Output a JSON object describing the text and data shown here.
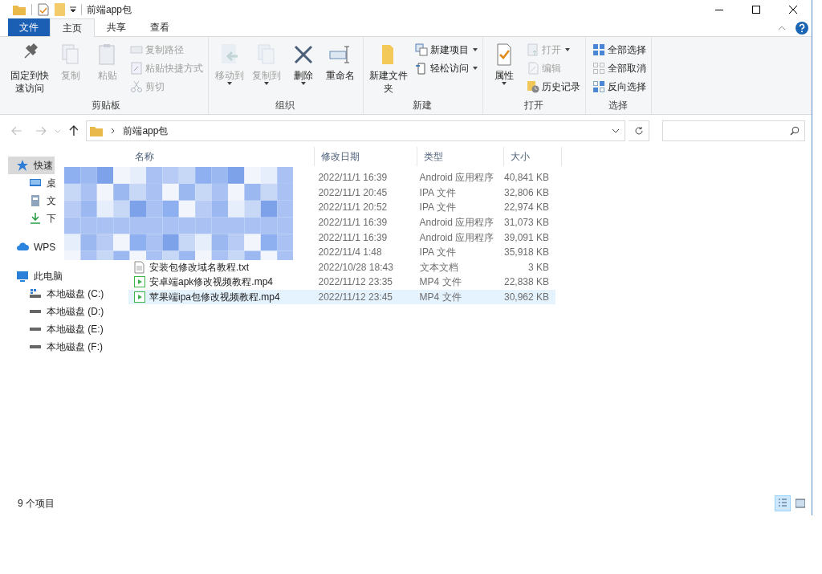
{
  "window": {
    "title": "前端app包"
  },
  "ribbon": {
    "tabs": [
      {
        "label": "文件",
        "kind": "file",
        "selected": false
      },
      {
        "label": "主页",
        "kind": "tab",
        "selected": true
      },
      {
        "label": "共享",
        "kind": "tab",
        "selected": false
      },
      {
        "label": "查看",
        "kind": "tab",
        "selected": false
      }
    ],
    "groups": [
      {
        "label": "剪贴板",
        "items": [
          {
            "label": "固定到快速访问",
            "kind": "large",
            "disabled": false,
            "menu": false
          },
          {
            "label": "复制",
            "kind": "large",
            "disabled": true,
            "menu": false
          },
          {
            "label": "粘贴",
            "kind": "large",
            "disabled": true,
            "menu": false
          },
          {
            "label": "复制路径",
            "kind": "small",
            "disabled": true,
            "menu": false
          },
          {
            "label": "粘贴快捷方式",
            "kind": "small",
            "disabled": true,
            "menu": false
          },
          {
            "label": "剪切",
            "kind": "small",
            "disabled": true,
            "menu": false
          }
        ]
      },
      {
        "label": "组织",
        "items": [
          {
            "label": "移动到",
            "kind": "large",
            "disabled": true,
            "menu": true
          },
          {
            "label": "复制到",
            "kind": "large",
            "disabled": true,
            "menu": true
          },
          {
            "label": "删除",
            "kind": "large",
            "disabled": false,
            "menu": true
          },
          {
            "label": "重命名",
            "kind": "large",
            "disabled": false,
            "menu": false
          }
        ]
      },
      {
        "label": "新建",
        "items": [
          {
            "label": "新建文件夹",
            "kind": "large",
            "disabled": false,
            "menu": false
          },
          {
            "label": "新建项目",
            "kind": "small",
            "disabled": false,
            "menu": true
          },
          {
            "label": "轻松访问",
            "kind": "small",
            "disabled": false,
            "menu": true
          }
        ]
      },
      {
        "label": "打开",
        "items": [
          {
            "label": "属性",
            "kind": "large",
            "disabled": false,
            "menu": true
          },
          {
            "label": "打开",
            "kind": "small",
            "disabled": true,
            "menu": true
          },
          {
            "label": "编辑",
            "kind": "small",
            "disabled": true,
            "menu": false
          },
          {
            "label": "历史记录",
            "kind": "small",
            "disabled": false,
            "menu": false
          }
        ]
      },
      {
        "label": "选择",
        "items": [
          {
            "label": "全部选择",
            "kind": "small",
            "disabled": false,
            "menu": false
          },
          {
            "label": "全部取消",
            "kind": "small",
            "disabled": false,
            "menu": false
          },
          {
            "label": "反向选择",
            "kind": "small",
            "disabled": false,
            "menu": false
          }
        ]
      }
    ]
  },
  "address_bar": {
    "path": "前端app包"
  },
  "sidebar": {
    "items": [
      {
        "label": "快速",
        "kind": "star",
        "selected": true,
        "children": [
          {
            "label": "桌",
            "kind": "desktop",
            "selected": false
          },
          {
            "label": "文",
            "kind": "docs",
            "selected": false
          },
          {
            "label": "下",
            "kind": "download",
            "selected": false
          }
        ]
      },
      {
        "label": "WPS",
        "kind": "cloud",
        "selected": false
      },
      {
        "label": "此电脑",
        "kind": "pc",
        "selected": false,
        "children": [
          {
            "label": "本地磁盘 (C:)",
            "kind": "sysdrive",
            "selected": false
          },
          {
            "label": "本地磁盘 (D:)",
            "kind": "drive",
            "selected": false
          },
          {
            "label": "本地磁盘 (E:)",
            "kind": "drive",
            "selected": false
          },
          {
            "label": "本地磁盘 (F:)",
            "kind": "drive",
            "selected": false
          }
        ]
      }
    ]
  },
  "table": {
    "columns": [
      "名称",
      "修改日期",
      "类型",
      "大小"
    ],
    "rows": [
      {
        "date": "2022/11/1 16:39",
        "type": "Android 应用程序",
        "size": "40,841 KB",
        "selected": false
      },
      {
        "date": "2022/11/1 20:45",
        "type": "IPA 文件",
        "size": "32,806 KB",
        "selected": false
      },
      {
        "date": "2022/11/1 20:52",
        "type": "IPA 文件",
        "size": "22,974 KB",
        "selected": false
      },
      {
        "date": "2022/11/1 16:39",
        "type": "Android 应用程序",
        "size": "31,073 KB",
        "selected": false
      },
      {
        "date": "2022/11/1 16:39",
        "type": "Android 应用程序",
        "size": "39,091 KB",
        "selected": false
      },
      {
        "date": "2022/11/4 1:48",
        "type": "IPA 文件",
        "size": "35,918 KB",
        "selected": false
      },
      {
        "name": "安装包修改域名教程.txt",
        "kind": "text",
        "date": "2022/10/28 18:43",
        "type": "文本文档",
        "size": "3 KB",
        "selected": false
      },
      {
        "name": "安卓端apk修改视频教程.mp4",
        "kind": "video",
        "date": "2022/11/12 23:35",
        "type": "MP4 文件",
        "size": "22,838 KB",
        "selected": false
      },
      {
        "name": "苹果端ipa包修改视频教程.mp4",
        "kind": "video",
        "date": "2022/11/12 23:45",
        "type": "MP4 文件",
        "size": "30,962 KB",
        "selected": true
      }
    ]
  },
  "status_bar": {
    "count": "9 个项目",
    "views": [
      {
        "kind": "details",
        "selected": true
      },
      {
        "kind": "large",
        "selected": false
      }
    ]
  }
}
